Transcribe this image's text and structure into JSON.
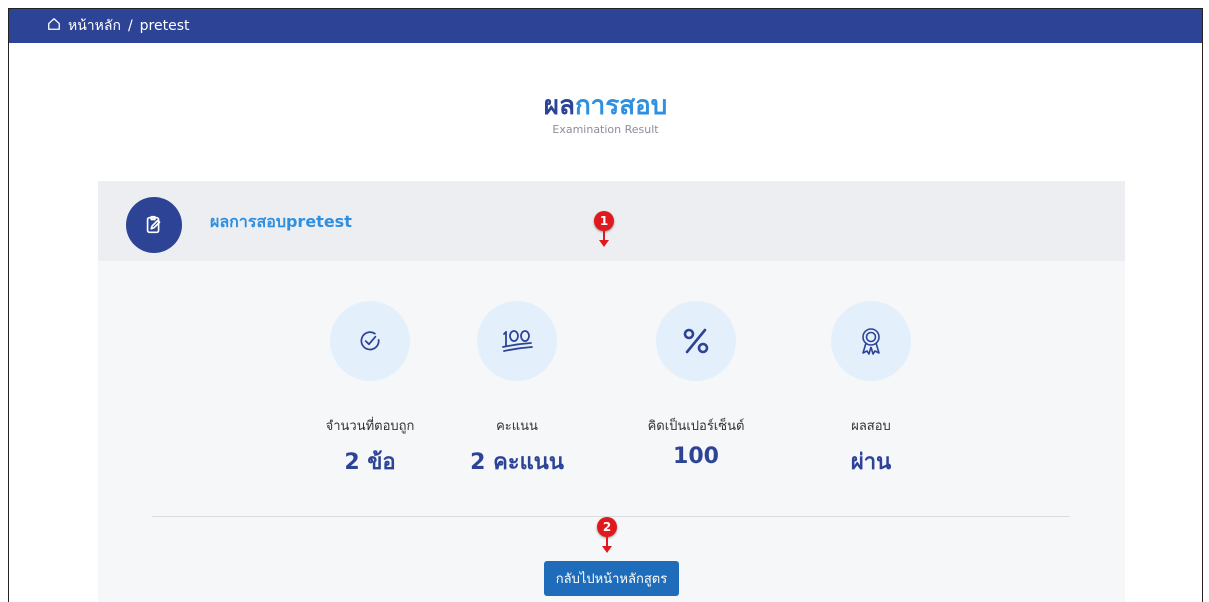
{
  "breadcrumb": {
    "home": "หน้าหลัก",
    "separator": "/",
    "current": "pretest"
  },
  "header": {
    "title_part1": "ผล",
    "title_part2": "การสอบ",
    "subtitle": "Examination Result"
  },
  "card": {
    "title": "ผลการสอบpretest"
  },
  "stats": [
    {
      "icon": "check-circle-icon",
      "label": "จำนวนที่ตอบถูก",
      "value": "2 ข้อ"
    },
    {
      "icon": "hundred-icon",
      "label": "คะแนน",
      "value": "2 คะแนน"
    },
    {
      "icon": "percent-icon",
      "label": "คิดเป็นเปอร์เซ็นต์",
      "value": "100"
    },
    {
      "icon": "award-icon",
      "label": "ผลสอบ",
      "value": "ผ่าน"
    }
  ],
  "back_button": {
    "label": "กลับไปหน้าหลักสูตร"
  },
  "markers": [
    "1",
    "2"
  ],
  "colors": {
    "topbar": "#2d4496",
    "accent": "#2f8fe0",
    "button": "#1f6dba",
    "marker": "#e0191f"
  }
}
